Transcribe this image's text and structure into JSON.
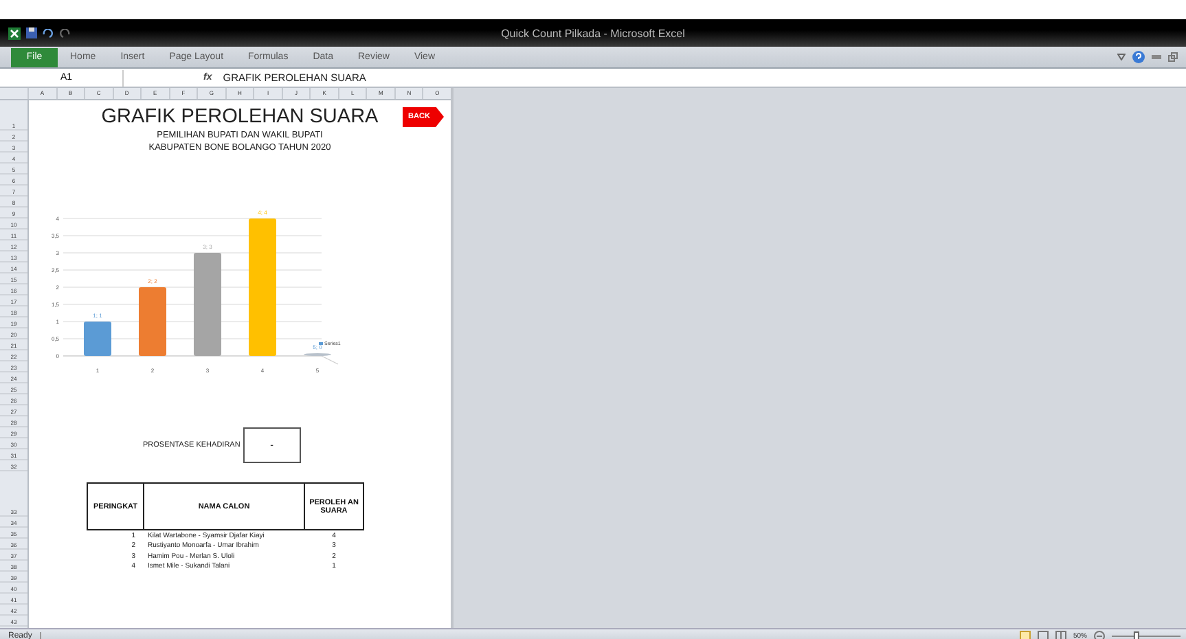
{
  "window": {
    "title": "Quick Count Pilkada - Microsoft Excel"
  },
  "ribbon": {
    "file_tab": "File",
    "tabs": [
      "Home",
      "Insert",
      "Page Layout",
      "Formulas",
      "Data",
      "Review",
      "View"
    ]
  },
  "formula_bar": {
    "name_box": "A1",
    "fx": "fx",
    "value": "GRAFIK PEROLEHAN SUARA"
  },
  "column_headers": [
    "A",
    "B",
    "C",
    "D",
    "E",
    "F",
    "G",
    "H",
    "I",
    "J",
    "K",
    "L",
    "M",
    "N",
    "O"
  ],
  "row_headers": [
    {
      "label": "1",
      "kind": "title"
    },
    {
      "label": "2",
      "kind": "normal"
    },
    {
      "label": "3",
      "kind": "normal"
    },
    {
      "label": "4",
      "kind": "normal"
    },
    {
      "label": "5",
      "kind": "normal"
    },
    {
      "label": "6",
      "kind": "normal"
    },
    {
      "label": "7",
      "kind": "normal"
    },
    {
      "label": "8",
      "kind": "normal"
    },
    {
      "label": "9",
      "kind": "normal"
    },
    {
      "label": "10",
      "kind": "normal"
    },
    {
      "label": "11",
      "kind": "normal"
    },
    {
      "label": "12",
      "kind": "normal"
    },
    {
      "label": "13",
      "kind": "normal"
    },
    {
      "label": "14",
      "kind": "normal"
    },
    {
      "label": "15",
      "kind": "normal"
    },
    {
      "label": "16",
      "kind": "normal"
    },
    {
      "label": "17",
      "kind": "normal"
    },
    {
      "label": "18",
      "kind": "normal"
    },
    {
      "label": "19",
      "kind": "normal"
    },
    {
      "label": "20",
      "kind": "normal"
    },
    {
      "label": "21",
      "kind": "normal"
    },
    {
      "label": "22",
      "kind": "normal"
    },
    {
      "label": "23",
      "kind": "normal"
    },
    {
      "label": "24",
      "kind": "normal"
    },
    {
      "label": "25",
      "kind": "normal"
    },
    {
      "label": "26",
      "kind": "normal"
    },
    {
      "label": "27",
      "kind": "normal"
    },
    {
      "label": "28",
      "kind": "normal"
    },
    {
      "label": "29",
      "kind": "normal"
    },
    {
      "label": "30",
      "kind": "normal"
    },
    {
      "label": "31",
      "kind": "normal"
    },
    {
      "label": "32",
      "kind": "normal"
    },
    {
      "label": "33",
      "kind": "header"
    },
    {
      "label": "34",
      "kind": "normal"
    },
    {
      "label": "35",
      "kind": "normal"
    },
    {
      "label": "36",
      "kind": "normal"
    },
    {
      "label": "37",
      "kind": "normal"
    },
    {
      "label": "38",
      "kind": "normal"
    },
    {
      "label": "39",
      "kind": "normal"
    },
    {
      "label": "40",
      "kind": "normal"
    },
    {
      "label": "41",
      "kind": "normal"
    },
    {
      "label": "42",
      "kind": "normal"
    },
    {
      "label": "43",
      "kind": "normal"
    }
  ],
  "sheet": {
    "title": "GRAFIK PEROLEHAN SUARA",
    "back_button": "BACK",
    "subtitles": [
      "PEMILIHAN BUPATI DAN WAKIL BUPATI",
      "KABUPATEN BONE BOLANGO TAHUN 2020"
    ],
    "chart_data": {
      "type": "bar",
      "categories": [
        "1",
        "2",
        "3",
        "4",
        "5"
      ],
      "stacked": true,
      "grid": true,
      "series": [
        {
          "name": "Series1",
          "color": "#5b9bd5",
          "values": [
            1,
            null,
            null,
            null,
            0
          ]
        },
        {
          "color": "#ed7d31",
          "values": [
            null,
            2,
            null,
            null,
            null
          ]
        },
        {
          "color": "#a5a5a5",
          "values": [
            null,
            null,
            3,
            null,
            null
          ]
        },
        {
          "color": "#ffc000",
          "values": [
            null,
            null,
            null,
            4,
            null
          ]
        }
      ],
      "ylim": [
        0,
        4
      ],
      "yticks": [
        {
          "value": 0,
          "label": "0"
        },
        {
          "value": 0.5,
          "label": "0,5"
        },
        {
          "value": 1,
          "label": "1"
        },
        {
          "value": 1.5,
          "label": "1,5"
        },
        {
          "value": 2,
          "label": "2"
        },
        {
          "value": 2.5,
          "label": "2,5"
        },
        {
          "value": 3,
          "label": "3"
        },
        {
          "value": 3.5,
          "label": "3,5"
        },
        {
          "value": 4,
          "label": "4"
        }
      ],
      "value_labels": [
        "1; 1",
        "2; 2",
        "3; 3",
        "4; 4",
        "5; 0"
      ]
    },
    "attendance": {
      "label": "PROSENTASE KEHADIRAN",
      "value": "-"
    },
    "table": {
      "columns": [
        "PERINGKAT",
        "NAMA CALON",
        "PEROLEH AN SUARA"
      ],
      "rows": [
        [
          "1",
          "Kilat Wartabone - Syamsir Djafar Kiayi",
          "4"
        ],
        [
          "2",
          "Rustiyanto Monoarfa - Umar Ibrahim",
          "3"
        ],
        [
          "3",
          "Hamim Pou - Merlan S. Uloli",
          "2"
        ],
        [
          "4",
          "Ismet Mile - Sukandi Talani",
          "1"
        ]
      ]
    }
  },
  "status_bar": {
    "status": "Ready",
    "zoom": "50%",
    "zoom_slider": {
      "level": 0.35
    }
  }
}
